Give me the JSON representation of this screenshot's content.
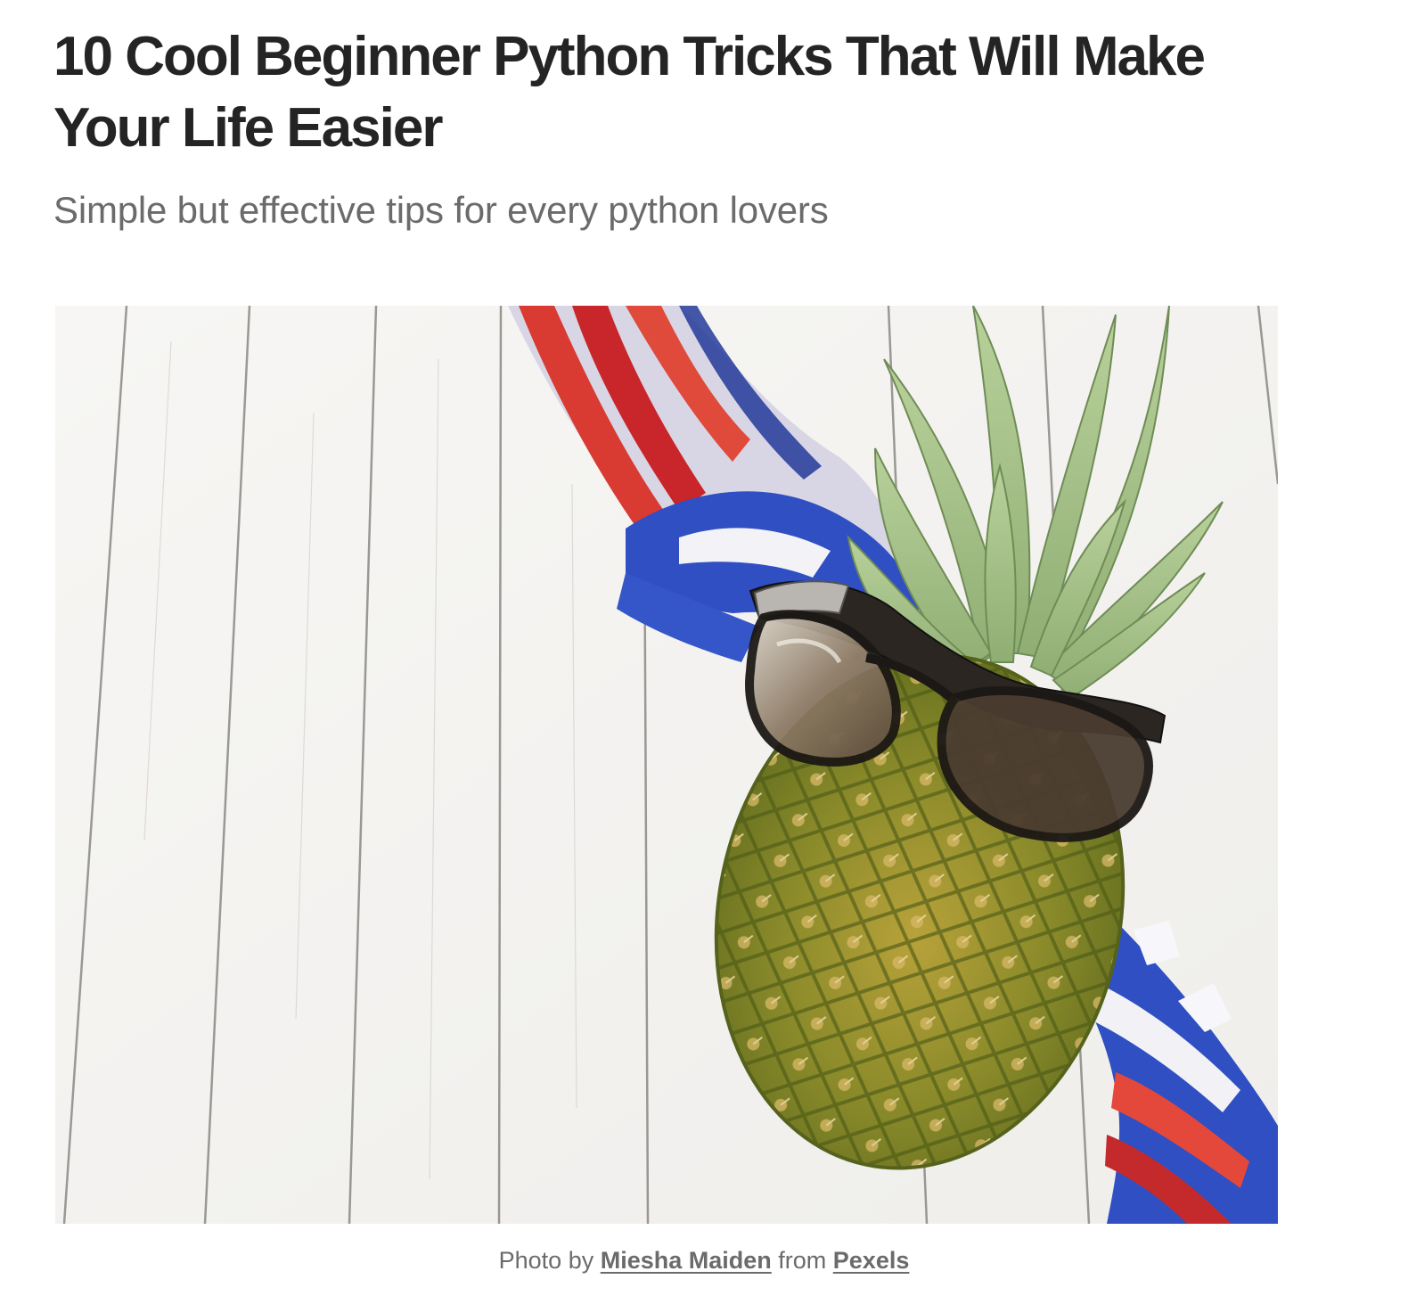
{
  "article": {
    "title": "10 Cool Beginner Python Tricks That Will Make Your Life Easier",
    "subtitle": "Simple but effective tips for every python lovers"
  },
  "hero_image": {
    "subject": "pineapple-with-sunglasses-and-flag-scarf"
  },
  "caption": {
    "prefix": "Photo by ",
    "author_link": "Miesha Maiden",
    "middle": " from ",
    "source_link": "Pexels"
  },
  "colors": {
    "title": "#242424",
    "subtitle": "#6b6b6b",
    "caption": "#6b6b6b"
  }
}
